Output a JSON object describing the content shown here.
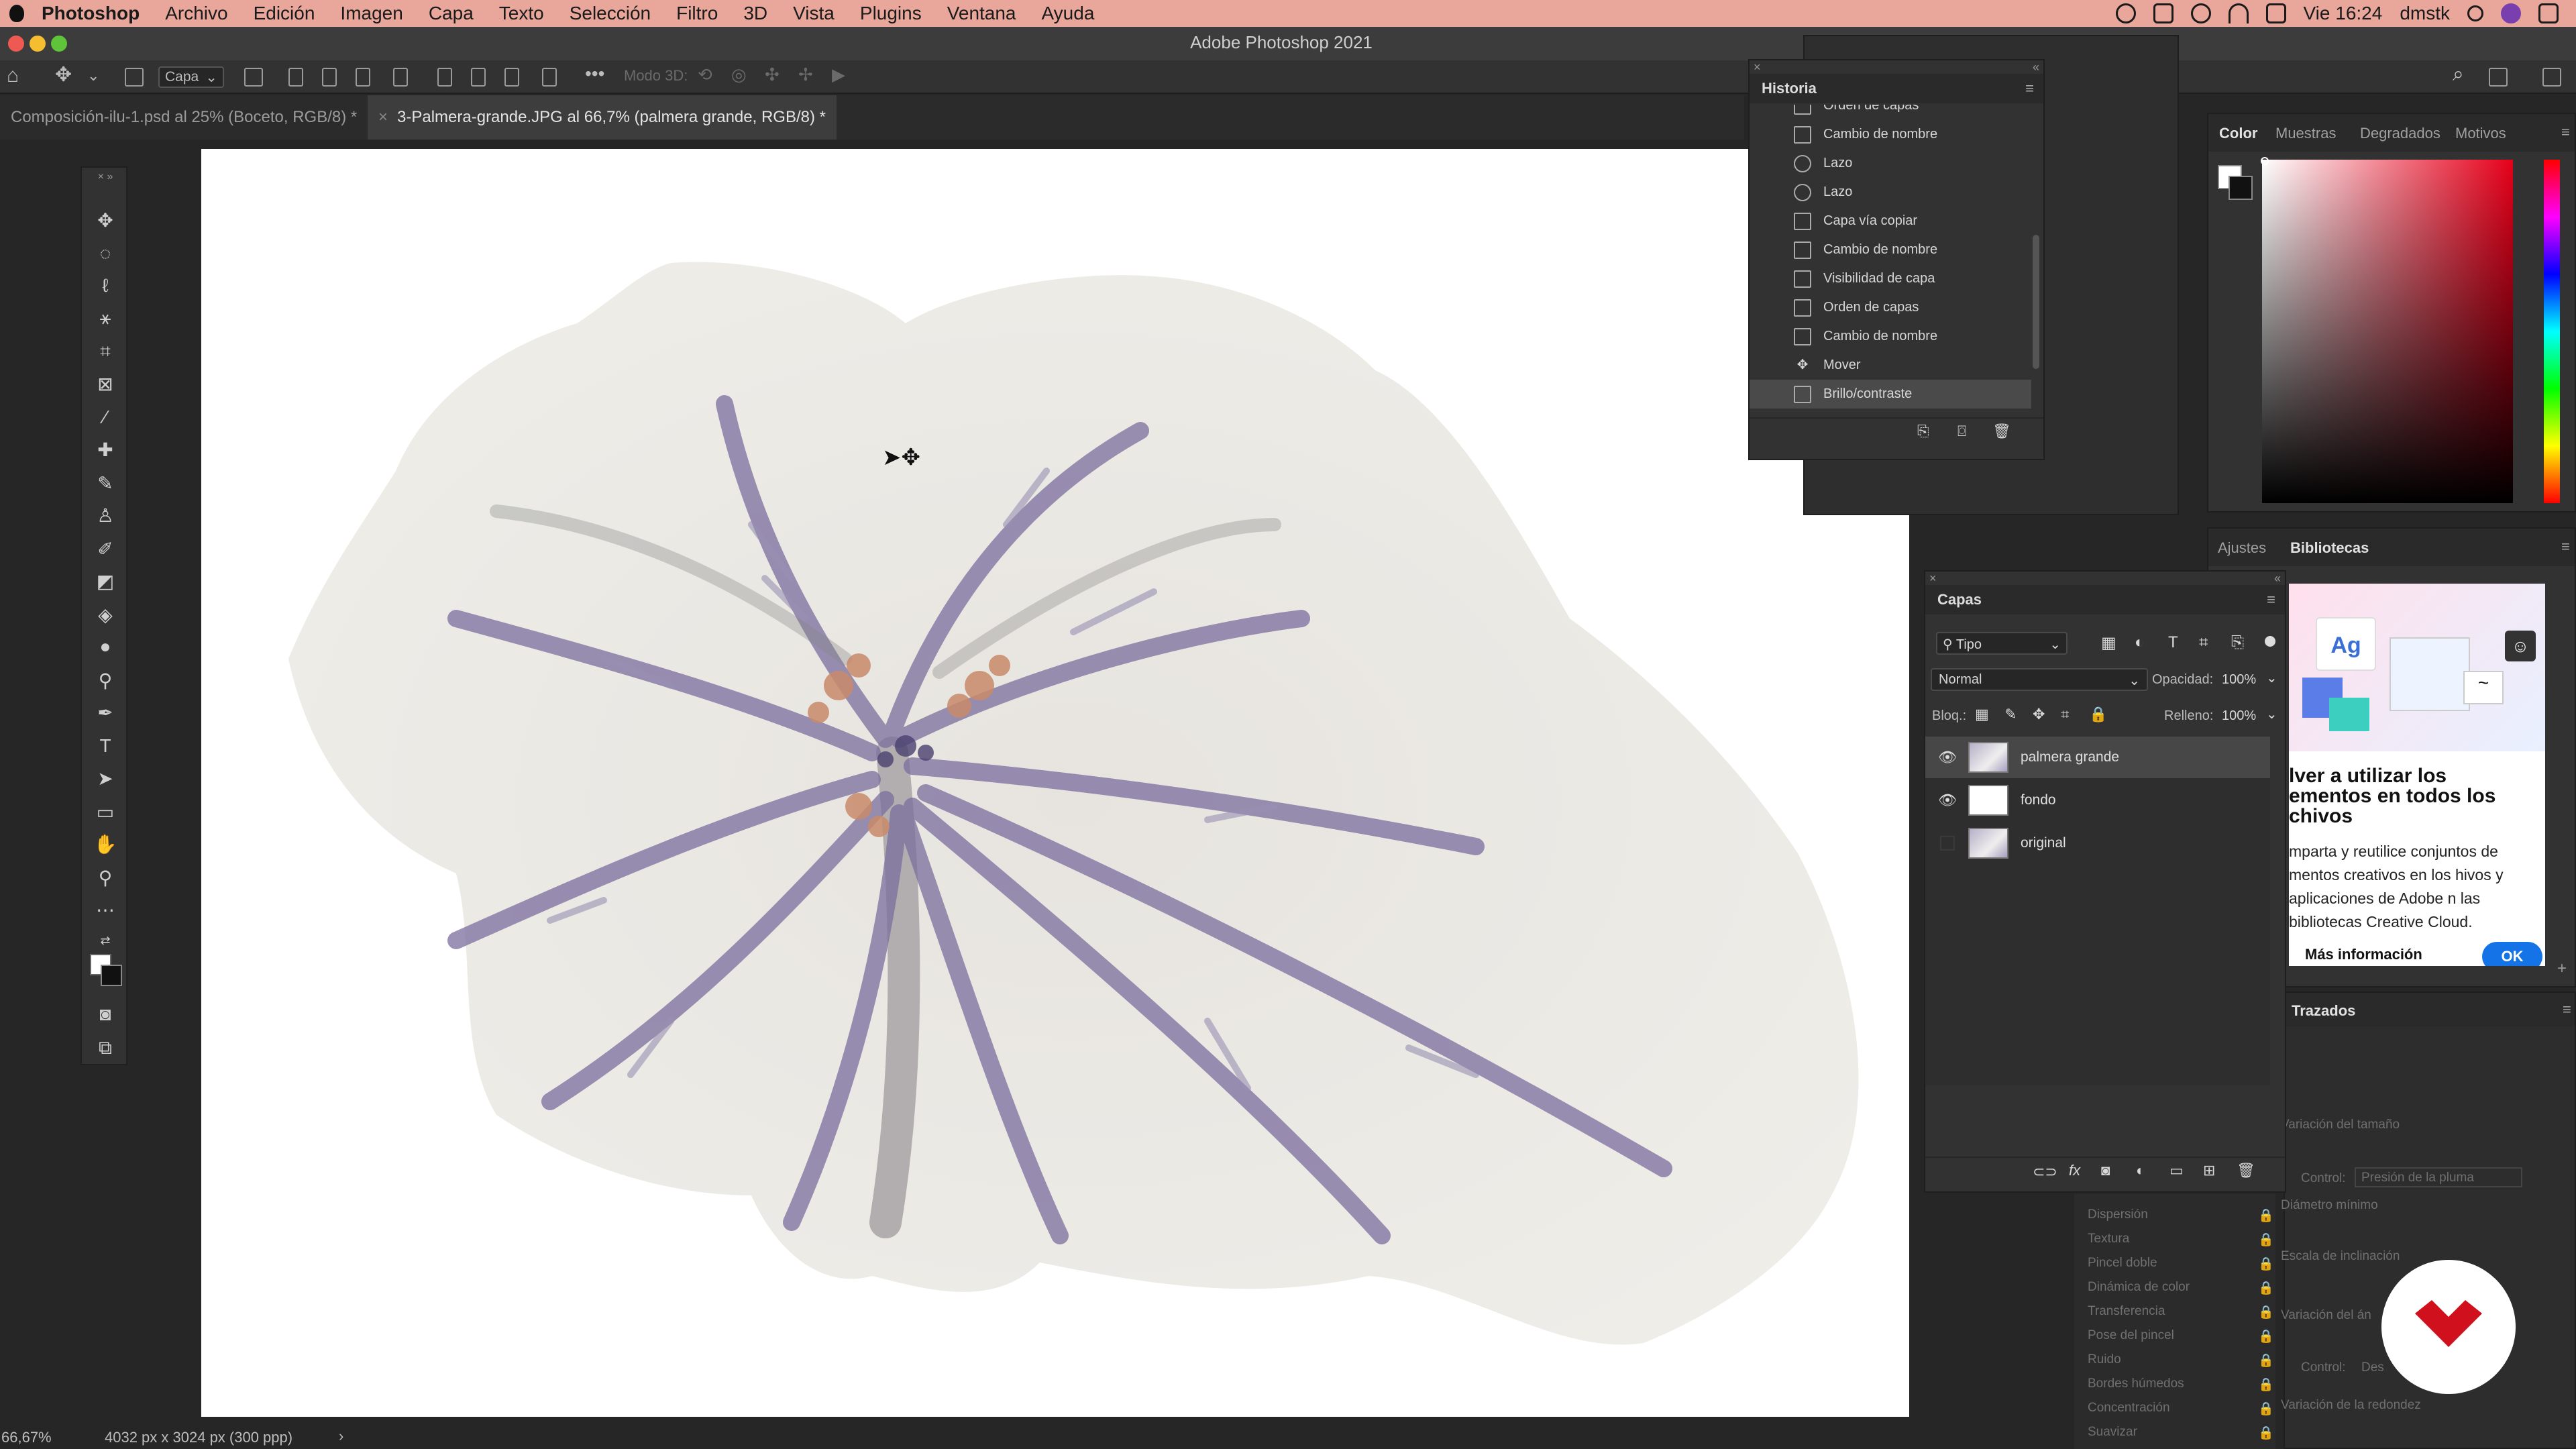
{
  "menubar": {
    "items": [
      "Photoshop",
      "Archivo",
      "Edición",
      "Imagen",
      "Capa",
      "Texto",
      "Selección",
      "Filtro",
      "3D",
      "Vista",
      "Plugins",
      "Ventana",
      "Ayuda"
    ],
    "clock": "Vie 16:24",
    "user": "dmstk"
  },
  "window": {
    "title": "Adobe Photoshop 2021"
  },
  "options": {
    "layer_select": "Capa",
    "mode3d": "Modo 3D:"
  },
  "tabs": [
    {
      "label": "Composición-ilu-1.psd al 25% (Boceto, RGB/8) *"
    },
    {
      "label": "3-Palmera-grande.JPG al 66,7% (palmera grande, RGB/8) *"
    }
  ],
  "status": {
    "zoom": "66,67%",
    "dimensions": "4032 px x 3024 px (300 ppp)"
  },
  "history": {
    "title": "Historia",
    "items": [
      "Orden de capas",
      "Cambio de nombre",
      "Lazo",
      "Lazo",
      "Capa vía copiar",
      "Cambio de nombre",
      "Visibilidad de capa",
      "Orden de capas",
      "Cambio de nombre",
      "Mover",
      "Brillo/contraste"
    ],
    "selected_index": 10
  },
  "color_panel": {
    "tabs": [
      "Color",
      "Muestras",
      "Degradados",
      "Motivos"
    ]
  },
  "ajustes_panel": {
    "tabs": [
      "Ajustes",
      "Bibliotecas"
    ],
    "heading": "lver a utilizar los ementos en todos los chivos",
    "body": "mparta y reutilice conjuntos de mentos creativos en los hivos y aplicaciones de Adobe n las bibliotecas Creative Cloud.",
    "link": "Más información",
    "ok": "OK",
    "card_text": "Ag"
  },
  "trazados_panel": {
    "tab": "Trazados"
  },
  "layers": {
    "title": "Capas",
    "filter": "Tipo",
    "blend": "Normal",
    "opacity_label": "Opacidad:",
    "opacity": "100%",
    "lock_label": "Bloq.:",
    "fill_label": "Relleno:",
    "fill": "100%",
    "items": [
      {
        "name": "palmera grande",
        "visible": true,
        "selected": true
      },
      {
        "name": "fondo",
        "visible": true,
        "selected": false
      },
      {
        "name": "original",
        "visible": false,
        "selected": false
      }
    ]
  },
  "brush_settings": {
    "options": [
      "Dispersión",
      "Textura",
      "Pincel doble",
      "Dinámica de color",
      "Transferencia",
      "Pose del pincel",
      "Ruido",
      "Bordes húmedos",
      "Concentración",
      "Suavizar"
    ],
    "labels": {
      "size_var": "Variación del tamaño",
      "control": "Control:",
      "control_value": "Presión de la pluma",
      "min_diam": "Diámetro mínimo",
      "tilt": "Escala de inclinación",
      "angle_var": "Variación del án",
      "control2_value": "Des",
      "round_var": "Variación de la redondez"
    }
  }
}
